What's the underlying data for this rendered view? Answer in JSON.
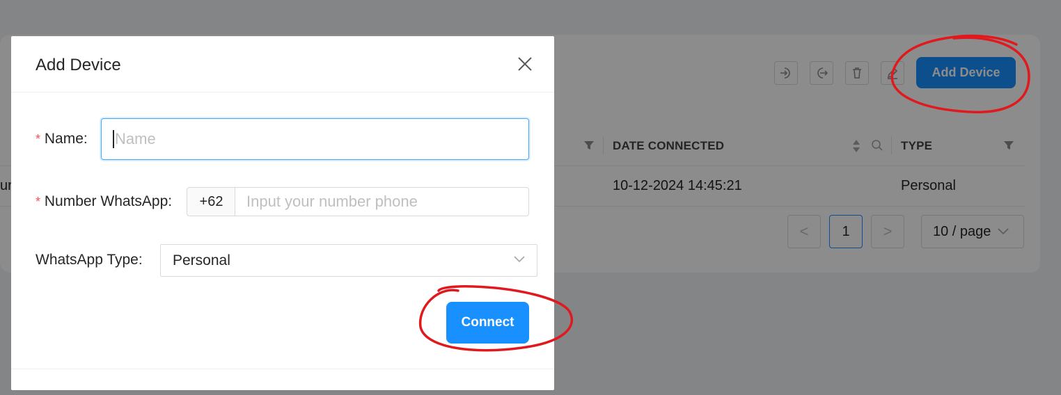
{
  "background": {
    "toolbar": {
      "icons": [
        "login-icon",
        "logout-icon",
        "delete-icon",
        "edit-icon"
      ],
      "add_device_label": "Add Device"
    },
    "table": {
      "columns": [
        {
          "label": "DATE CONNECTED",
          "icons": [
            "sort-icon",
            "search-icon"
          ]
        },
        {
          "label": "TYPE",
          "icons": [
            "filter-icon"
          ]
        }
      ],
      "rows": [
        {
          "partial_left": "ur",
          "date_connected": "10-12-2024 14:45:21",
          "type": "Personal"
        }
      ]
    },
    "pagination": {
      "prev": "<",
      "current_page": "1",
      "next": ">",
      "page_size": "10 / page"
    }
  },
  "modal": {
    "title": "Add Device",
    "fields": {
      "name": {
        "label": "Name",
        "colon": ":",
        "placeholder": "Name",
        "value": ""
      },
      "whatsapp_number": {
        "label": "Number WhatsApp",
        "colon": ":",
        "prefix": "+62",
        "placeholder": "Input your number phone",
        "value": ""
      },
      "whatsapp_type": {
        "label": "WhatsApp Type",
        "colon": ":",
        "selected": "Personal"
      }
    },
    "required_mark": "*",
    "connect_label": "Connect"
  },
  "colors": {
    "primary": "#1890ff",
    "required": "#ff4d4f",
    "annotation": "#e0191e"
  }
}
